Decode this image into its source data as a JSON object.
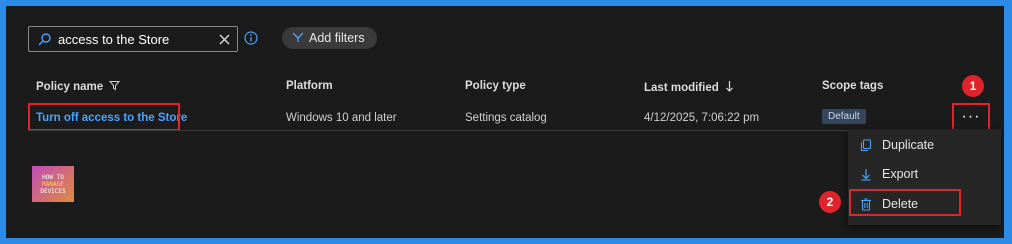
{
  "search": {
    "value": "access to the Store"
  },
  "filters": {
    "label": "Add filters"
  },
  "columns": {
    "policy_name": "Policy name",
    "platform": "Platform",
    "policy_type": "Policy type",
    "last_modified": "Last modified",
    "scope_tags": "Scope tags"
  },
  "row": {
    "policy_name": "Turn off access to the Store",
    "platform": "Windows 10 and later",
    "policy_type": "Settings catalog",
    "last_modified": "4/12/2025, 7:06:22 pm",
    "scope_tag": "Default"
  },
  "more": {
    "label": "···"
  },
  "menu": {
    "duplicate": "Duplicate",
    "export": "Export",
    "delete": "Delete"
  },
  "steps": {
    "one": "1",
    "two": "2"
  },
  "logo": {
    "line1": "HOW TO",
    "line2": "MANAGE",
    "line3": "DEVICES"
  },
  "icons": [
    "search-icon",
    "clear-icon",
    "info-icon",
    "filter-icon",
    "funnel-icon",
    "sort-down-icon",
    "copy-icon",
    "download-icon",
    "trash-icon"
  ],
  "colors": {
    "accent": "#4aa3ff",
    "highlight": "#e0242c",
    "frame": "#2b8be6"
  }
}
